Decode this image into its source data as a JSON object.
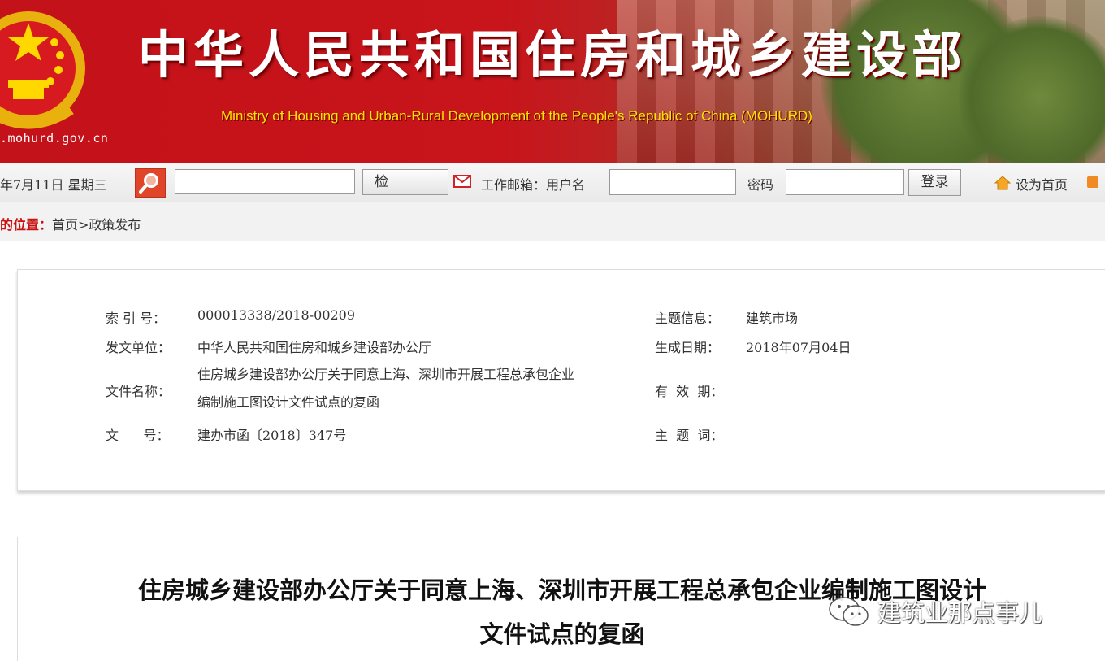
{
  "banner": {
    "site_url": ".mohurd.gov.cn",
    "title_cn": "中华人民共和国住房和城乡建设部",
    "title_en": "Ministry of Housing and Urban-Rural Development of the People's Republic of China (MOHURD)"
  },
  "toolbar": {
    "date": "年7月11日  星期三",
    "search_button": "检 索",
    "mail_label": "工作邮箱：用户名",
    "password_label": "密码",
    "login_button": "登录",
    "set_homepage": "设为首页"
  },
  "breadcrumb": {
    "label": "的位置：",
    "path": "首页>政策发布"
  },
  "info": {
    "index_label": "索 引 号：",
    "index_value": "000013338/2018-00209",
    "issuer_label": "发文单位：",
    "issuer_value": "中华人民共和国住房和城乡建设部办公厅",
    "filename_label": "文件名称：",
    "filename_value": "住房城乡建设部办公厅关于同意上海、深圳市开展工程总承包企业编制施工图设计文件试点的复函",
    "docno_label": "文      号：",
    "docno_value": "建办市函〔2018〕347号",
    "topic_label": "主题信息：",
    "topic_value": "建筑市场",
    "date_label": "生成日期：",
    "date_value": "2018年07月04日",
    "validity_label": "有  效  期：",
    "validity_value": "",
    "keywords_label": "主  题  词：",
    "keywords_value": ""
  },
  "document": {
    "title_line1": "住房城乡建设部办公厅关于同意上海、深圳市开展工程总承包企业编制施工图设计",
    "title_line2": "文件试点的复函"
  },
  "watermark": {
    "text": "建筑业那点事儿"
  },
  "colors": {
    "banner_red": "#c4121a",
    "title_yellow": "#ffe500",
    "breadcrumb_red": "#c81212",
    "search_icon_bg": "#e0452a"
  }
}
